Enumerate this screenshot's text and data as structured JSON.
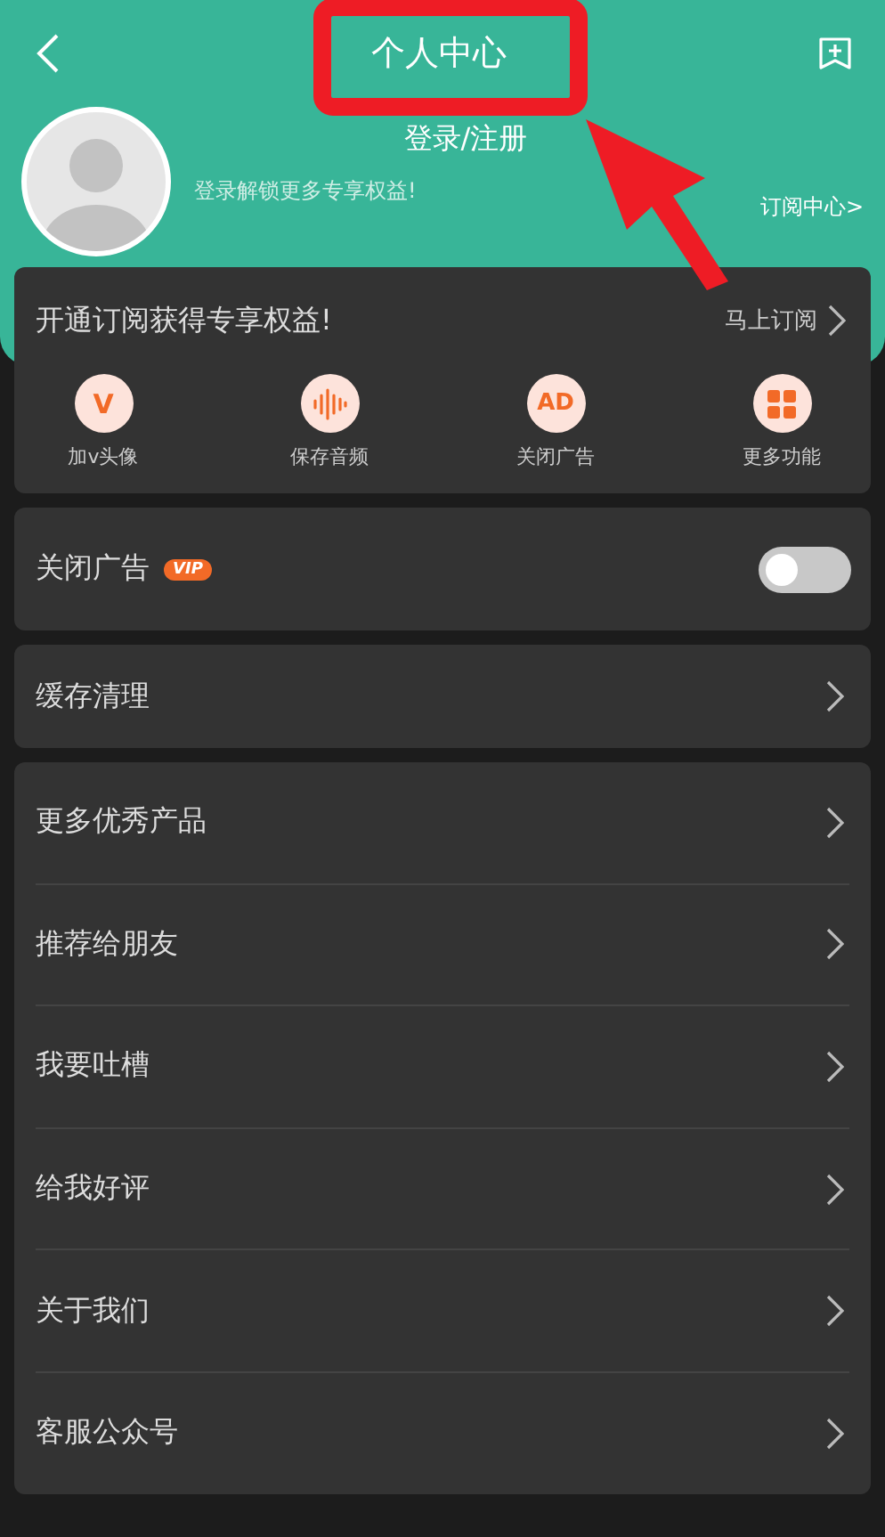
{
  "header": {
    "title": "个人中心",
    "login": "登录/注册",
    "login_hint": "登录解锁更多专享权益!",
    "subscribe_center": "订阅中心>"
  },
  "subscription": {
    "title": "开通订阅获得专享权益!",
    "action": "马上订阅",
    "features": [
      {
        "kind": "letter",
        "glyph": "V",
        "label": "加v头像"
      },
      {
        "kind": "wave",
        "label": "保存音频"
      },
      {
        "kind": "letter",
        "glyph": "AD",
        "label": "关闭广告"
      },
      {
        "kind": "grid",
        "label": "更多功能"
      }
    ]
  },
  "ad_toggle": {
    "label": "关闭广告",
    "badge": "VIP",
    "on": false
  },
  "cache": {
    "label": "缓存清理"
  },
  "menu": [
    {
      "label": "更多优秀产品"
    },
    {
      "label": "推荐给朋友"
    },
    {
      "label": "我要吐槽"
    },
    {
      "label": "给我好评"
    },
    {
      "label": "关于我们"
    },
    {
      "label": "客服公众号"
    }
  ]
}
